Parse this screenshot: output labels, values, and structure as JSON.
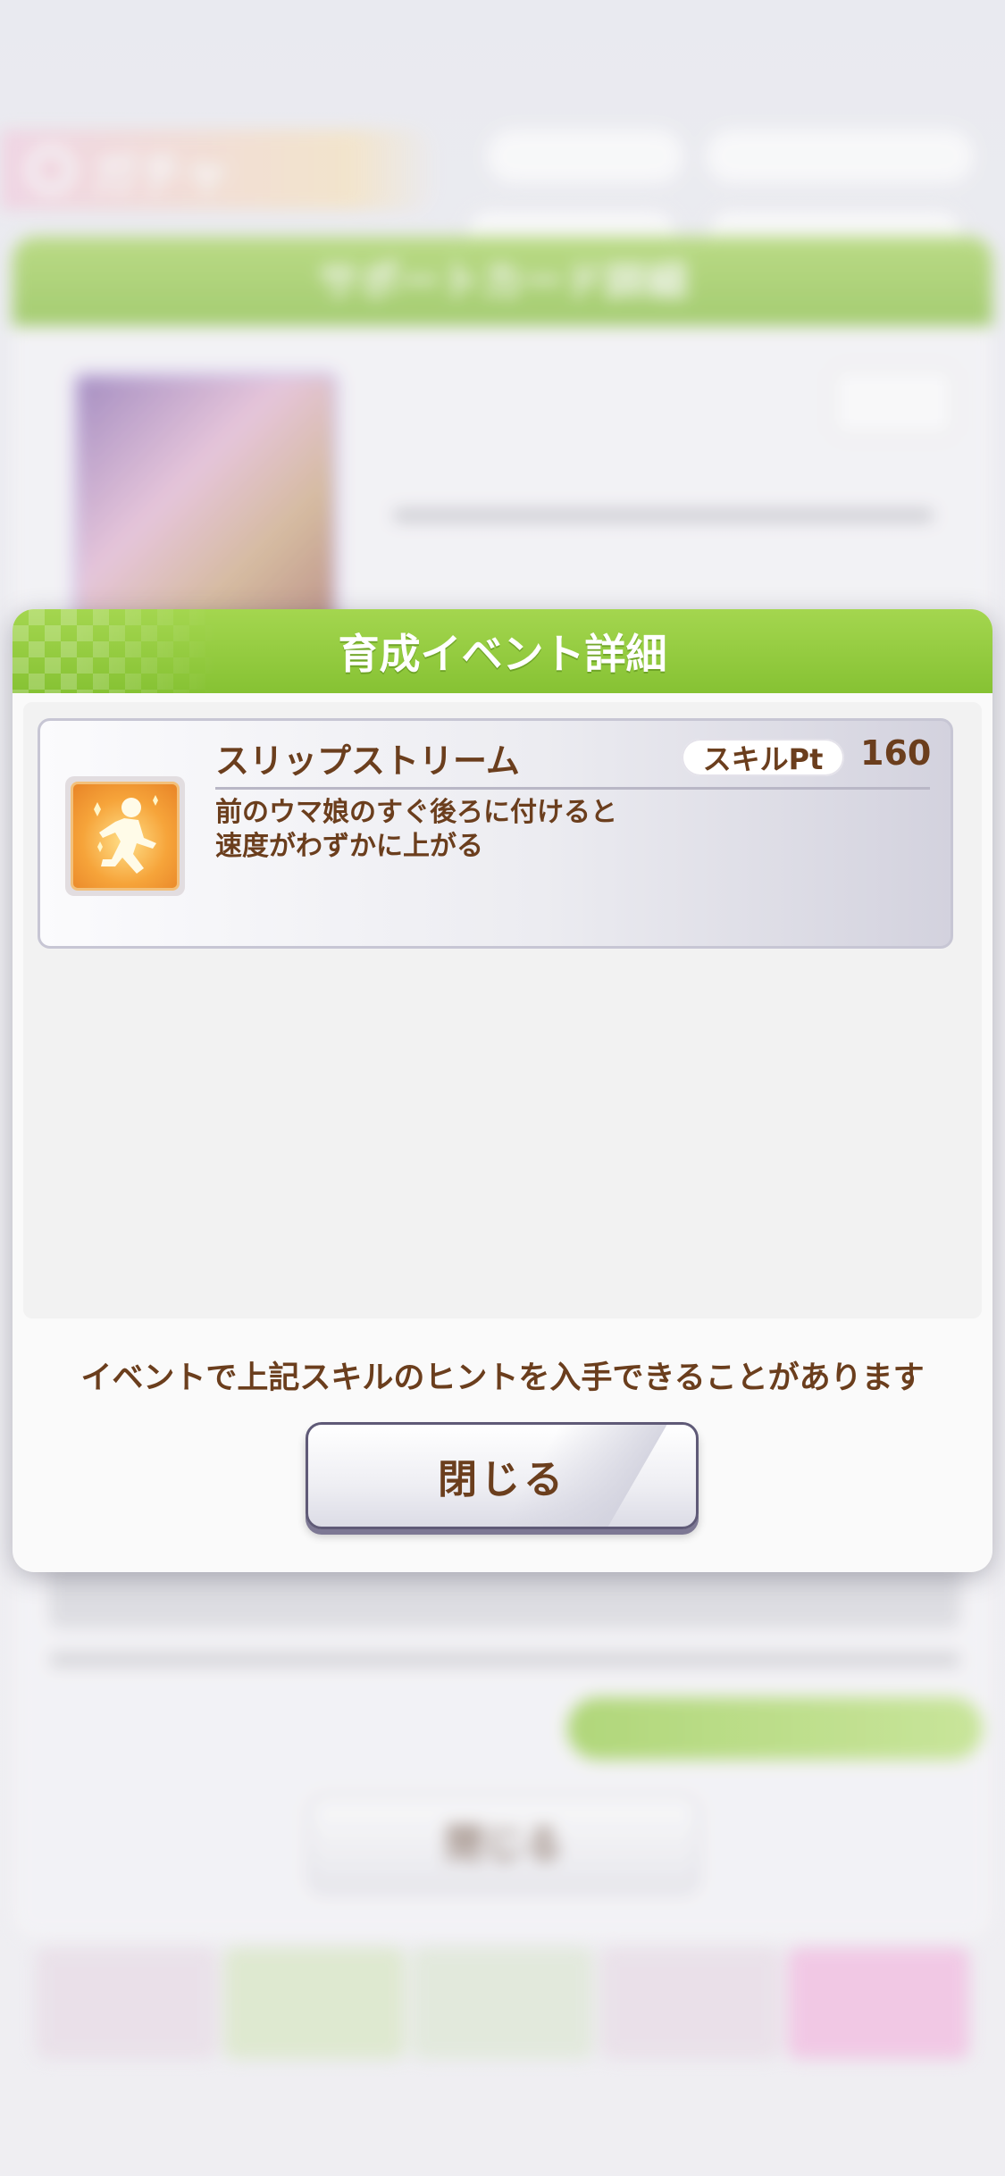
{
  "background": {
    "tab_title": "ガチャ",
    "panel_title": "サポートカード詳細",
    "close_label": "閉じる"
  },
  "modal": {
    "title": "育成イベント詳細",
    "skill": {
      "name": "スリップストリーム",
      "pt_label": "スキルPt",
      "pt_value": "160",
      "description_line1": "前のウマ娘のすぐ後ろに付けると",
      "description_line2": "速度がわずかに上がる",
      "icon": "running-figure-icon"
    },
    "hint": "イベントで上記スキルのヒントを入手できることがあります",
    "close_label": "閉じる"
  },
  "colors": {
    "header_green": "#86c233",
    "text_brown": "#6b3e1d",
    "icon_orange": "#f6a43a"
  }
}
